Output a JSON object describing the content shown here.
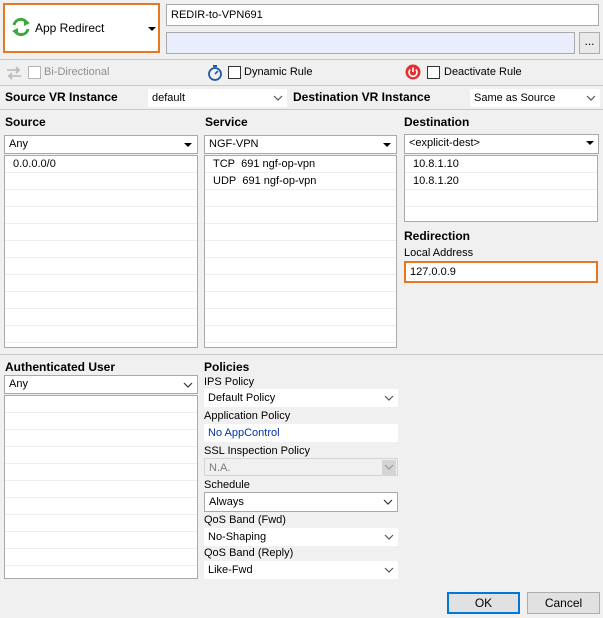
{
  "rule_type": {
    "label": "App Redirect",
    "icon": "refresh-arrows-icon"
  },
  "rule_name": "REDIR-to-VPN691",
  "rule_description": "",
  "browse_label": "...",
  "options": {
    "bidirectional": {
      "label": "Bi-Directional",
      "checked": false,
      "enabled": false
    },
    "dynamic_rule": {
      "label": "Dynamic Rule",
      "checked": false
    },
    "deactivate_rule": {
      "label": "Deactivate Rule",
      "checked": false
    }
  },
  "source_vr": {
    "label": "Source VR Instance",
    "value": "default"
  },
  "destination_vr": {
    "label": "Destination VR Instance",
    "value": "Same as Source"
  },
  "source": {
    "label": "Source",
    "selected": "Any",
    "items": [
      "0.0.0.0/0"
    ]
  },
  "service": {
    "label": "Service",
    "selected": "NGF-VPN",
    "items": [
      {
        "proto": "TCP",
        "port": "691",
        "name": "ngf-op-vpn"
      },
      {
        "proto": "UDP",
        "port": "691",
        "name": "ngf-op-vpn"
      }
    ]
  },
  "destination": {
    "label": "Destination",
    "selected": "<explicit-dest>",
    "items": [
      "10.8.1.10",
      "10.8.1.20"
    ]
  },
  "redirection": {
    "label": "Redirection",
    "local_address_label": "Local Address",
    "local_address": "127.0.0.9"
  },
  "auth_user": {
    "label": "Authenticated User",
    "selected": "Any"
  },
  "policies": {
    "label": "Policies",
    "ips": {
      "label": "IPS Policy",
      "value": "Default Policy"
    },
    "application": {
      "label": "Application Policy",
      "value": "No AppControl"
    },
    "ssl": {
      "label": "SSL Inspection Policy",
      "value": "N.A."
    },
    "schedule": {
      "label": "Schedule",
      "value": "Always"
    },
    "qos_fwd": {
      "label": "QoS Band (Fwd)",
      "value": "No-Shaping"
    },
    "qos_reply": {
      "label": "QoS Band (Reply)",
      "value": "Like-Fwd"
    }
  },
  "buttons": {
    "ok": "OK",
    "cancel": "Cancel"
  },
  "colors": {
    "accent_orange": "#e87722",
    "link_blue": "#0033aa",
    "ok_border": "#0078d7"
  }
}
